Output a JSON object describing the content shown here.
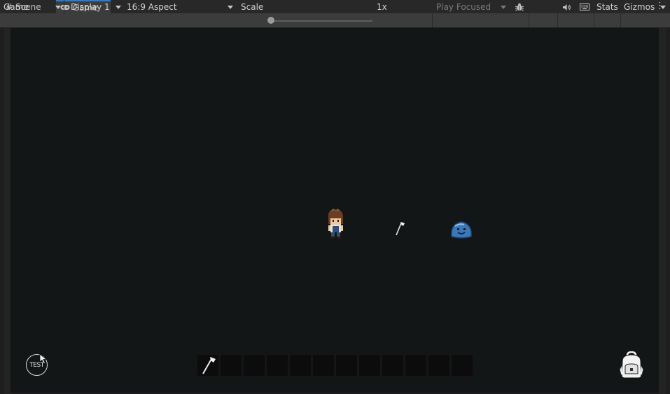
{
  "tabs": {
    "scene_label": "Scene",
    "game_label": "Game",
    "more_icon": "kebab-menu-icon"
  },
  "toolbar": {
    "view_mode": "Game",
    "display": "Display 1",
    "aspect": "16:9 Aspect",
    "scale_label": "Scale",
    "scale_value": "1x",
    "play_mode": "Play Focused",
    "stats_label": "Stats",
    "gizmos_label": "Gizmos"
  },
  "game": {
    "test_button_label": "TEST",
    "hotbar_slot_count": 12,
    "hotbar_first_item": "axe-icon"
  },
  "colors": {
    "game_background": "#131616",
    "toolbar": "#3c3c3c",
    "accent_tab": "#3a79bb"
  }
}
